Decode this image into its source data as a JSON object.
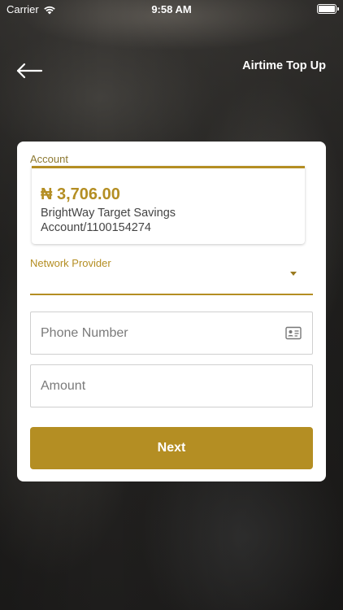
{
  "status_bar": {
    "carrier": "Carrier",
    "time": "9:58 AM"
  },
  "header": {
    "title": "Airtime Top Up",
    "back_icon": "arrow-left-icon"
  },
  "account": {
    "label": "Account",
    "amount": "₦ 3,706.00",
    "name": "BrightWay Target Savings Account/1100154274"
  },
  "network_provider": {
    "label": "Network Provider",
    "value": ""
  },
  "phone": {
    "placeholder": "Phone Number",
    "value": "",
    "icon": "contact-card-icon"
  },
  "amount": {
    "placeholder": "Amount",
    "value": ""
  },
  "next_button": {
    "label": "Next"
  },
  "colors": {
    "accent": "#b48e23",
    "card": "#ffffff"
  }
}
